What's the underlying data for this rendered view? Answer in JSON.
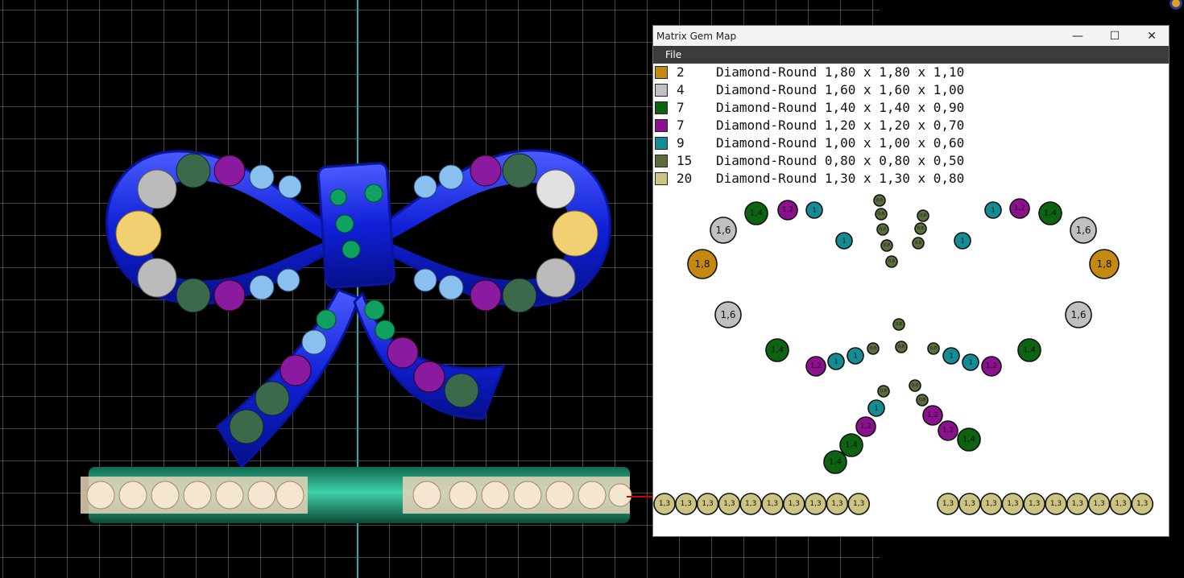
{
  "window": {
    "title": "Matrix Gem Map",
    "controls": {
      "minimize": "—",
      "maximize": "☐",
      "close": "✕"
    }
  },
  "menu": {
    "file": "File"
  },
  "colors": {
    "viewport_background": "#000000",
    "grid_line": "#5a5a5a",
    "axis_line": "#1ab0c0"
  },
  "legend": [
    {
      "count": "2",
      "desc": "Diamond-Round 1,80 x 1,80 x 1,10",
      "color": "#c48a10"
    },
    {
      "count": "4",
      "desc": "Diamond-Round 1,60 x 1,60 x 1,00",
      "color": "#c0c0c0"
    },
    {
      "count": "7",
      "desc": "Diamond-Round 1,40 x 1,40 x 0,90",
      "color": "#0c6410"
    },
    {
      "count": "7",
      "desc": "Diamond-Round 1,20 x 1,20 x 0,70",
      "color": "#8c1090"
    },
    {
      "count": "9",
      "desc": "Diamond-Round 1,00 x 1,00 x 0,60",
      "color": "#148c96"
    },
    {
      "count": "15",
      "desc": "Diamond-Round 0,80 x 0,80 x 0,50",
      "color": "#5a6e3c"
    },
    {
      "count": "20",
      "desc": "Diamond-Round 1,30 x 1,30 x 0,80",
      "color": "#cdc484"
    }
  ],
  "gem_labels": {
    "s18": "1,8",
    "s16": "1,6",
    "s14": "1,4",
    "s12": "1,2",
    "s10": "1",
    "s08": "0,8",
    "s13": "1,3"
  }
}
